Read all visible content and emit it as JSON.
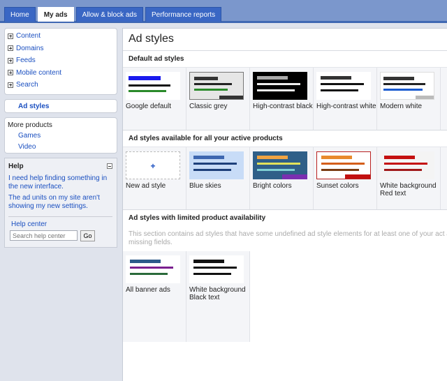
{
  "tabs": [
    {
      "label": "Home"
    },
    {
      "label": "My ads"
    },
    {
      "label": "Allow & block ads"
    },
    {
      "label": "Performance reports"
    }
  ],
  "sidebar": {
    "nav": [
      {
        "label": "Content"
      },
      {
        "label": "Domains"
      },
      {
        "label": "Feeds"
      },
      {
        "label": "Mobile content"
      },
      {
        "label": "Search"
      }
    ],
    "ad_styles_label": "Ad styles",
    "more_title": "More products",
    "more_links": [
      {
        "label": "Games"
      },
      {
        "label": "Video"
      }
    ],
    "help": {
      "title": "Help",
      "links": [
        {
          "label": "I need help finding something in the new interface."
        },
        {
          "label": "The ad units on my site aren't showing my new settings."
        }
      ],
      "center_label": "Help center",
      "search_placeholder": "Search help center",
      "go_label": "Go"
    }
  },
  "main": {
    "title": "Ad styles",
    "sections": [
      {
        "heading": "Default ad styles",
        "cards": [
          {
            "label": "Google default",
            "icon": "thumb-google-default"
          },
          {
            "label": "Classic grey",
            "icon": "thumb-classic-grey"
          },
          {
            "label": "High-contrast black",
            "icon": "thumb-high-contrast-black"
          },
          {
            "label": "High-contrast white",
            "icon": "thumb-high-contrast-white"
          },
          {
            "label": "Modern white",
            "icon": "thumb-modern-white"
          }
        ]
      },
      {
        "heading": "Ad styles available for all your active products",
        "cards": [
          {
            "label": "New ad style",
            "icon": "plus-icon"
          },
          {
            "label": "Blue skies",
            "icon": "thumb-blue-skies"
          },
          {
            "label": "Bright colors",
            "icon": "thumb-bright-colors"
          },
          {
            "label": "Sunset colors",
            "icon": "thumb-sunset-colors"
          },
          {
            "label": "White background Red text",
            "icon": "thumb-white-bg-red-text"
          }
        ]
      },
      {
        "heading": "Ad styles with limited product availability",
        "note": "This section contains ad styles that have some undefined ad style elements for at least one of your act and complete the missing fields.",
        "cards": [
          {
            "label": "All banner ads",
            "icon": "thumb-all-banner-ads"
          },
          {
            "label": "White background Black text",
            "icon": "thumb-white-bg-black-text"
          }
        ]
      }
    ],
    "new_style_symbol": "+"
  },
  "colors": {
    "tab_bar": "#7b97cc",
    "tab_active": "#3a67c4",
    "link": "#1a4fc0"
  }
}
